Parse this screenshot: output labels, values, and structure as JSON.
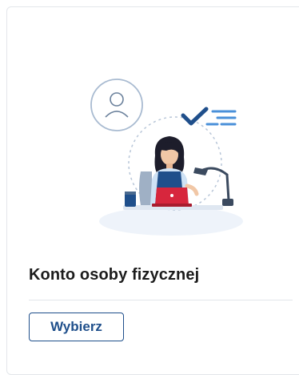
{
  "card": {
    "title": "Konto osoby fizycznej",
    "button_label": "Wybierz",
    "illustration_icon": "person-at-laptop-illustration"
  },
  "colors": {
    "accent_blue": "#1f4f8b",
    "light_blue": "#4a90d9",
    "laptop_red": "#d7263d",
    "border_gray": "#e3e6ea"
  }
}
